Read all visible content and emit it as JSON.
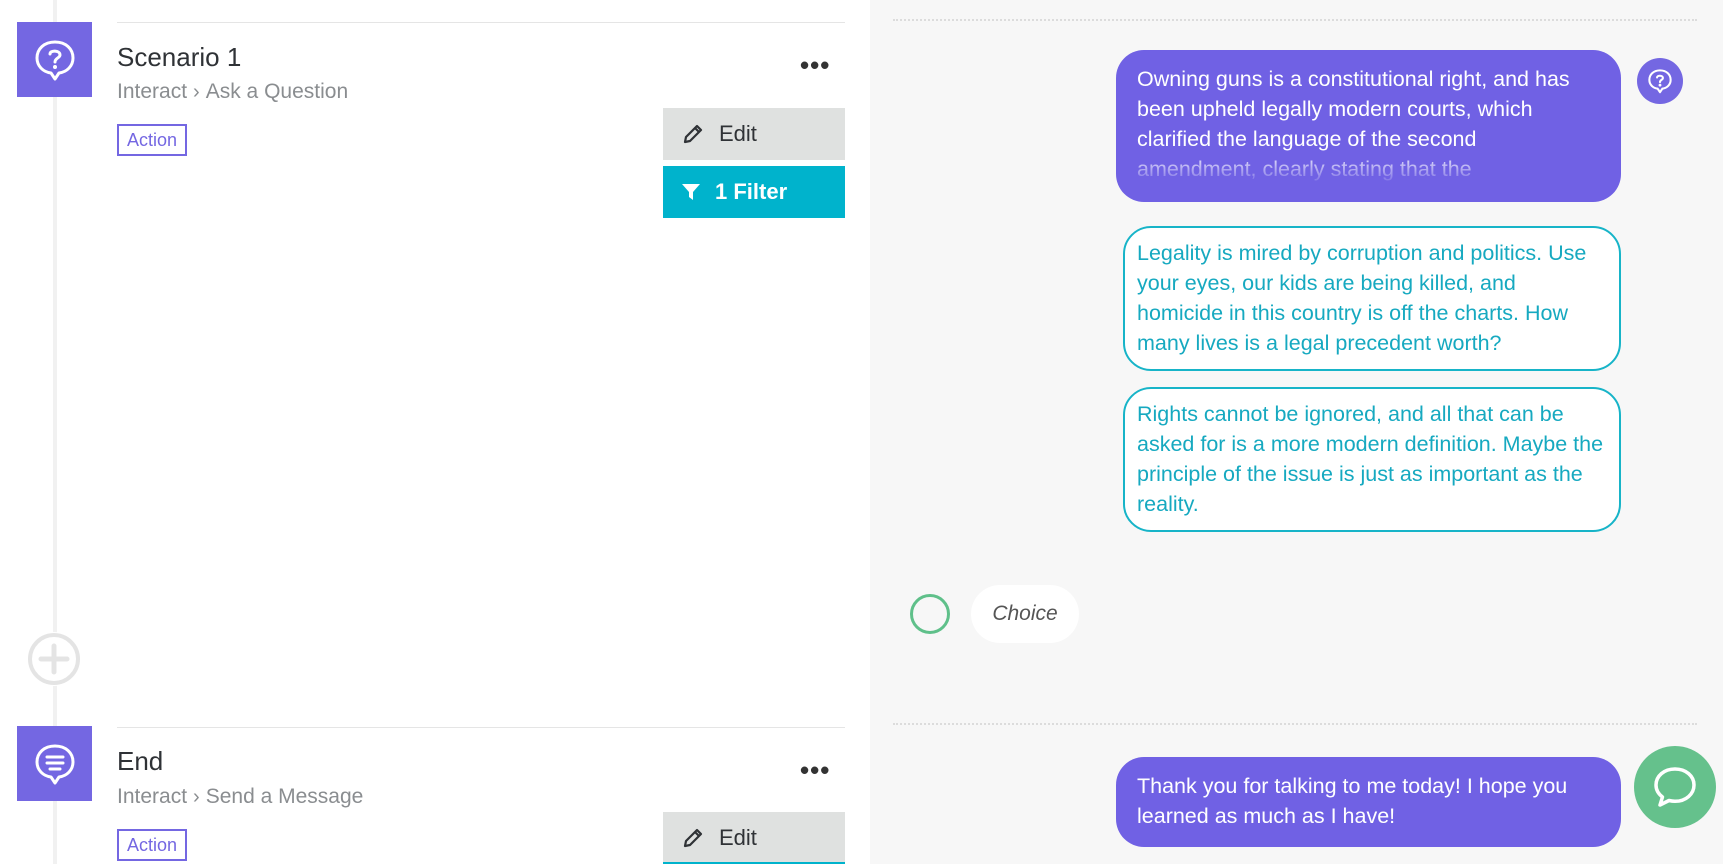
{
  "steps": [
    {
      "title": "Scenario 1",
      "breadcrumb_parent": "Interact",
      "breadcrumb_child": "Ask a Question",
      "badge": "Action",
      "more": "•••",
      "edit_label": "Edit",
      "filter_label": "1 Filter",
      "icon": "question-bubble-icon"
    },
    {
      "title": "End",
      "breadcrumb_parent": "Interact",
      "breadcrumb_child": "Send a Message",
      "badge": "Action",
      "more": "•••",
      "edit_label": "Edit",
      "icon": "message-bubble-icon"
    }
  ],
  "preview": {
    "question_message": "Owning guns is a constitutional right, and has been upheld legally modern courts, which clarified the language of the second amendment, clearly stating that the",
    "options": [
      "Legality is mired by corruption and politics. Use your eyes, our kids are being killed, and homicide in this country is off the charts. How many lives is a legal precedent worth?",
      "Rights cannot be ignored, and all that can be asked for is a more modern definition. Maybe the principle of the issue is just as important as the reality."
    ],
    "choice_label": "Choice",
    "end_message": "Thank you for talking to me today! I hope you learned as much as I have!"
  },
  "colors": {
    "accent_purple": "#7467e2",
    "filter_teal": "#00b3cc",
    "option_teal": "#17b4c8",
    "chat_green": "#65c18c"
  }
}
